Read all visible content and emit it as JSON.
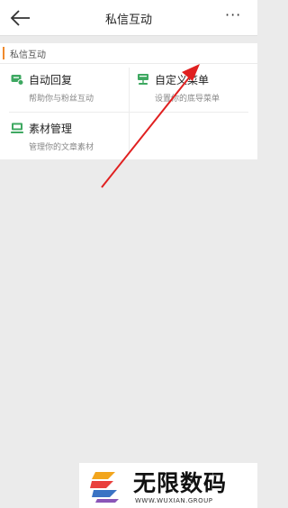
{
  "header": {
    "title": "私信互动",
    "back_icon": "arrow-left-icon",
    "more_icon": "more-dots-icon",
    "more_label": "···"
  },
  "section": {
    "label": "私信互动",
    "accent": "#f08a2c"
  },
  "items": [
    {
      "name": "自动回复",
      "desc": "帮助你与粉丝互动",
      "icon": "auto-reply-icon"
    },
    {
      "name": "自定义菜单",
      "desc": "设置你的底导菜单",
      "icon": "custom-menu-icon"
    },
    {
      "name": "素材管理",
      "desc": "管理你的文章素材",
      "icon": "material-manage-icon"
    }
  ],
  "icon_color": "#3ea861",
  "annotation_color": "#e02020",
  "watermark": {
    "brand": "无限数码",
    "sub": "WWW.WUXIAN.GROUP"
  }
}
